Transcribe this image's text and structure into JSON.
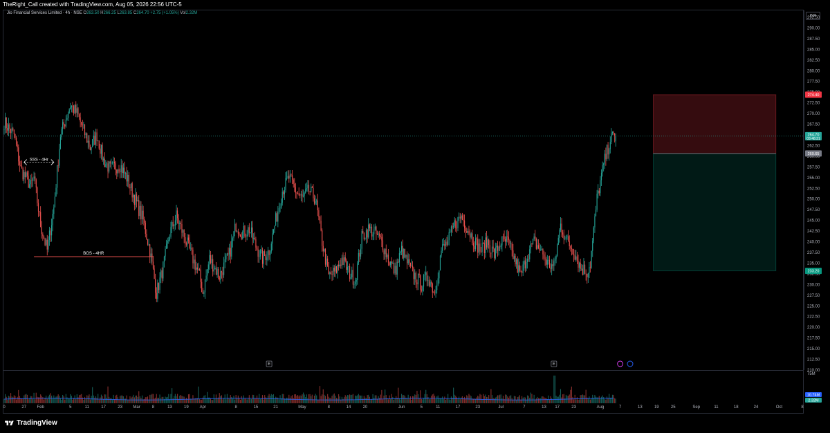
{
  "header": {
    "attribution": "TheRight_Call created with TradingView.com, Aug 05, 2026 22:56 UTC-5",
    "symbol": "Jio Financial Services Limited · 4h · NSE",
    "ohlc": {
      "open_label": "O",
      "open": "263.50",
      "high_label": "H",
      "high": "266.25",
      "low_label": "L",
      "low": "263.85",
      "close_label": "C",
      "close": "264.70",
      "change": "+2.75 (+1.05%)",
      "vol_label": "Vol",
      "vol": "2.32M"
    },
    "currency": "INR"
  },
  "footer": {
    "brand": "TradingView"
  },
  "colors": {
    "up": "#26a69a",
    "down": "#ef5350",
    "background": "#000000",
    "grid": "#1e222d",
    "text": "#b2b5be",
    "volume_ma": "#2962ff"
  },
  "chart_data": {
    "type": "candlestick",
    "title": "",
    "ylim": [
      210,
      292.5
    ],
    "y_ticks": [
      "292.50",
      "290.00",
      "287.50",
      "285.00",
      "282.50",
      "280.00",
      "277.50",
      "275.00",
      "272.50",
      "270.00",
      "267.50",
      "265.00",
      "262.50",
      "260.00",
      "257.50",
      "255.00",
      "252.50",
      "250.00",
      "247.50",
      "245.00",
      "242.50",
      "240.00",
      "237.50",
      "235.00",
      "232.50",
      "230.00",
      "227.50",
      "225.00",
      "222.50",
      "220.00",
      "217.50",
      "215.00",
      "212.50",
      "210.00"
    ],
    "x_ticks": [
      {
        "d": 0,
        "label": "0"
      },
      {
        "d": 6,
        "label": "27"
      },
      {
        "d": 11,
        "label": "Feb"
      },
      {
        "d": 20,
        "label": "5"
      },
      {
        "d": 25,
        "label": "11"
      },
      {
        "d": 30,
        "label": "17"
      },
      {
        "d": 35,
        "label": "23"
      },
      {
        "d": 40,
        "label": "Mar"
      },
      {
        "d": 45,
        "label": "8"
      },
      {
        "d": 50,
        "label": "13"
      },
      {
        "d": 55,
        "label": "19"
      },
      {
        "d": 60,
        "label": "Apr"
      },
      {
        "d": 70,
        "label": "8"
      },
      {
        "d": 76,
        "label": "15"
      },
      {
        "d": 82,
        "label": "21"
      },
      {
        "d": 90,
        "label": "May"
      },
      {
        "d": 98,
        "label": "8"
      },
      {
        "d": 104,
        "label": "14"
      },
      {
        "d": 109,
        "label": "20"
      },
      {
        "d": 120,
        "label": "Jun"
      },
      {
        "d": 126,
        "label": "5"
      },
      {
        "d": 131,
        "label": "11"
      },
      {
        "d": 137,
        "label": "17"
      },
      {
        "d": 143,
        "label": "23"
      },
      {
        "d": 150,
        "label": "Jul"
      },
      {
        "d": 157,
        "label": "7"
      },
      {
        "d": 163,
        "label": "13"
      },
      {
        "d": 167,
        "label": "17"
      },
      {
        "d": 172,
        "label": "23"
      },
      {
        "d": 180,
        "label": "Aug"
      },
      {
        "d": 186,
        "label": "7"
      },
      {
        "d": 192,
        "label": "13"
      },
      {
        "d": 197,
        "label": "19"
      },
      {
        "d": 202,
        "label": "25"
      },
      {
        "d": 209,
        "label": "Sep"
      },
      {
        "d": 215,
        "label": "11"
      },
      {
        "d": 221,
        "label": "18"
      },
      {
        "d": 227,
        "label": "24"
      },
      {
        "d": 234,
        "label": "Oct"
      },
      {
        "d": 241,
        "label": "8"
      }
    ],
    "anchors": [
      [
        0,
        268
      ],
      [
        3,
        265
      ],
      [
        5,
        257
      ],
      [
        8,
        253
      ],
      [
        9,
        255
      ],
      [
        11,
        244
      ],
      [
        13,
        238
      ],
      [
        15,
        248
      ],
      [
        17,
        265
      ],
      [
        20,
        272
      ],
      [
        22,
        270
      ],
      [
        24,
        266
      ],
      [
        26,
        262
      ],
      [
        28,
        265
      ],
      [
        30,
        259
      ],
      [
        32,
        257
      ],
      [
        35,
        258
      ],
      [
        37,
        255
      ],
      [
        40,
        249
      ],
      [
        42,
        245
      ],
      [
        44,
        238
      ],
      [
        46,
        228
      ],
      [
        48,
        234
      ],
      [
        50,
        242
      ],
      [
        52,
        246
      ],
      [
        55,
        240
      ],
      [
        57,
        236
      ],
      [
        59,
        232
      ],
      [
        60,
        228
      ],
      [
        62,
        236
      ],
      [
        65,
        232
      ],
      [
        68,
        237
      ],
      [
        70,
        244
      ],
      [
        72,
        242
      ],
      [
        74,
        243
      ],
      [
        76,
        239
      ],
      [
        78,
        236
      ],
      [
        80,
        238
      ],
      [
        82,
        245
      ],
      [
        84,
        252
      ],
      [
        86,
        255
      ],
      [
        88,
        252
      ],
      [
        90,
        250
      ],
      [
        92,
        252
      ],
      [
        94,
        250
      ],
      [
        96,
        240
      ],
      [
        98,
        232
      ],
      [
        100,
        233
      ],
      [
        102,
        236
      ],
      [
        104,
        233
      ],
      [
        106,
        231
      ],
      [
        108,
        241
      ],
      [
        110,
        243
      ],
      [
        112,
        242
      ],
      [
        114,
        240
      ],
      [
        116,
        236
      ],
      [
        118,
        233
      ],
      [
        120,
        238
      ],
      [
        123,
        233
      ],
      [
        126,
        230
      ],
      [
        128,
        232
      ],
      [
        130,
        228
      ],
      [
        132,
        238
      ],
      [
        134,
        240
      ],
      [
        136,
        244
      ],
      [
        138,
        246
      ],
      [
        140,
        243
      ],
      [
        142,
        240
      ],
      [
        144,
        238
      ],
      [
        146,
        240
      ],
      [
        148,
        237
      ],
      [
        150,
        240
      ],
      [
        152,
        240
      ],
      [
        154,
        236
      ],
      [
        156,
        232
      ],
      [
        158,
        237
      ],
      [
        160,
        240
      ],
      [
        162,
        238
      ],
      [
        164,
        235
      ],
      [
        166,
        234
      ],
      [
        168,
        244
      ],
      [
        170,
        240
      ],
      [
        172,
        238
      ],
      [
        174,
        234
      ],
      [
        176,
        233
      ],
      [
        177,
        235
      ],
      [
        179,
        250
      ],
      [
        181,
        258
      ],
      [
        183,
        264
      ],
      [
        185,
        265
      ]
    ],
    "last_candle": {
      "open": 263.5,
      "high": 266.25,
      "low": 263.85,
      "close": 264.7
    },
    "volume": {
      "max_label": "75M",
      "ma": "10.74M",
      "current": "2.32M"
    },
    "annotations": [
      {
        "type": "hline",
        "label": "BOS - 4HR",
        "price": 236.5,
        "d_start": 9,
        "d_end": 45
      },
      {
        "type": "sweep",
        "label": "SSS - 4Hr",
        "price": 258.6,
        "d_start": 6,
        "d_end": 15
      }
    ],
    "position": {
      "type": "long",
      "entry": 260.65,
      "stop": 233.2,
      "target": 274.4,
      "d_start": 196,
      "d_end": 233
    },
    "price_labels": {
      "target": "274.40",
      "last": "264.70",
      "countdown": "03:48:31",
      "entry": "260.65",
      "stop": "233.20"
    },
    "events": [
      {
        "d": 80,
        "icon": "E"
      },
      {
        "d": 166,
        "icon": "E"
      },
      {
        "d": 186,
        "icon": "dividend"
      },
      {
        "d": 189,
        "icon": "split"
      }
    ]
  }
}
